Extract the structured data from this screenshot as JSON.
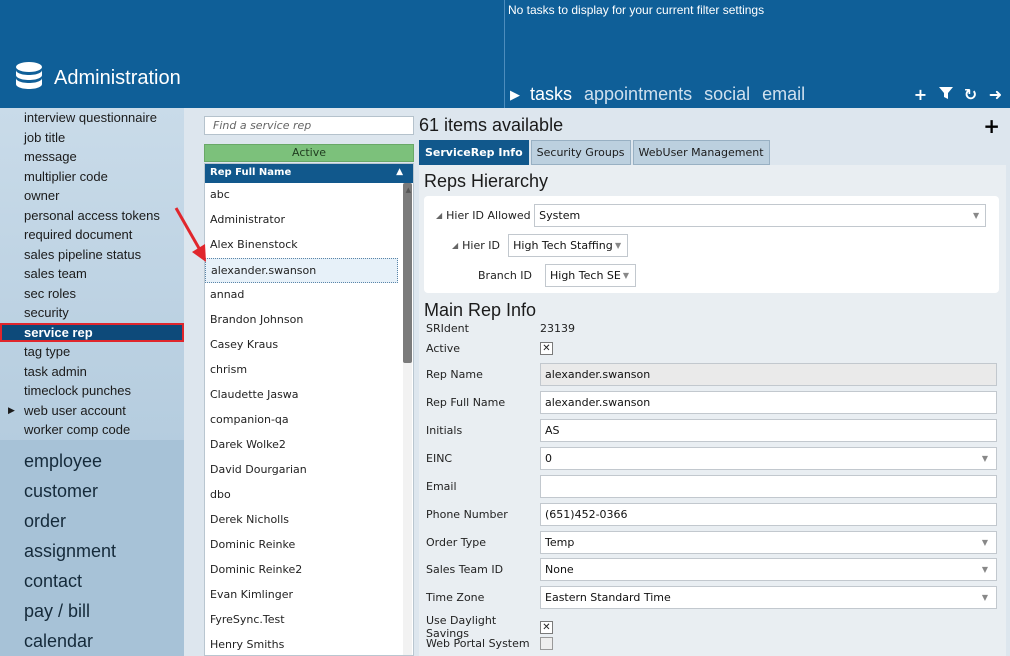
{
  "header": {
    "title": "Administration",
    "tasks_message": "No tasks to display for your current filter settings",
    "tabs": [
      {
        "label": "tasks",
        "active": true
      },
      {
        "label": "appointments",
        "active": false
      },
      {
        "label": "social",
        "active": false
      },
      {
        "label": "email",
        "active": false
      }
    ],
    "actions": [
      "plus-icon",
      "filter-icon",
      "refresh-icon",
      "arrow-right-icon"
    ]
  },
  "sidebar": {
    "sub_items": [
      {
        "label": "interview questionnaire"
      },
      {
        "label": "job title"
      },
      {
        "label": "message"
      },
      {
        "label": "multiplier code"
      },
      {
        "label": "owner"
      },
      {
        "label": "personal access tokens"
      },
      {
        "label": "required document"
      },
      {
        "label": "sales pipeline status"
      },
      {
        "label": "sales team"
      },
      {
        "label": "sec roles"
      },
      {
        "label": "security"
      },
      {
        "label": "service rep",
        "selected": true
      },
      {
        "label": "tag type"
      },
      {
        "label": "task admin"
      },
      {
        "label": "timeclock punches"
      },
      {
        "label": "web user account",
        "expandable": true
      },
      {
        "label": "worker comp code"
      }
    ],
    "main_items": [
      {
        "label": "employee"
      },
      {
        "label": "customer"
      },
      {
        "label": "order"
      },
      {
        "label": "assignment"
      },
      {
        "label": "contact"
      },
      {
        "label": "pay / bill"
      },
      {
        "label": "calendar"
      }
    ]
  },
  "list": {
    "search_placeholder": "Find a service rep",
    "filter_label": "Active",
    "column_header": "Rep Full Name",
    "items": [
      {
        "name": "abc"
      },
      {
        "name": "Administrator"
      },
      {
        "name": "Alex Binenstock"
      },
      {
        "name": "alexander.swanson",
        "selected": true
      },
      {
        "name": "annad"
      },
      {
        "name": "Brandon Johnson"
      },
      {
        "name": "Casey Kraus"
      },
      {
        "name": "chrism"
      },
      {
        "name": "Claudette Jaswa"
      },
      {
        "name": "companion-qa"
      },
      {
        "name": "Darek Wolke2"
      },
      {
        "name": "David Dourgarian"
      },
      {
        "name": "dbo"
      },
      {
        "name": "Derek Nicholls"
      },
      {
        "name": "Dominic Reinke"
      },
      {
        "name": "Dominic Reinke2"
      },
      {
        "name": "Evan Kimlinger"
      },
      {
        "name": "FyreSync.Test"
      },
      {
        "name": "Henry Smiths"
      }
    ]
  },
  "detail": {
    "count_text": "61 items available",
    "tabs": [
      {
        "label": "ServiceRep Info",
        "active": true
      },
      {
        "label": "Security Groups",
        "active": false
      },
      {
        "label": "WebUser Management",
        "active": false
      }
    ],
    "hierarchy": {
      "heading": "Reps Hierarchy",
      "hier_id_allowed_label": "Hier ID Allowed",
      "hier_id_allowed_value": "System",
      "hier_id_label": "Hier ID",
      "hier_id_value": "High Tech Staffing",
      "branch_id_label": "Branch ID",
      "branch_id_value": "High Tech SE"
    },
    "main": {
      "heading": "Main Rep Info",
      "srident_label": "SRIdent",
      "srident_value": "23139",
      "active_label": "Active",
      "active_checked": true,
      "fields": [
        {
          "label": "Rep Name",
          "value": "alexander.swanson",
          "readonly": true
        },
        {
          "label": "Rep Full Name",
          "value": "alexander.swanson"
        },
        {
          "label": "Initials",
          "value": "AS"
        },
        {
          "label": "EINC",
          "value": "0",
          "dropdown": true
        },
        {
          "label": "Email",
          "value": ""
        },
        {
          "label": "Phone Number",
          "value": "(651)452-0366"
        },
        {
          "label": "Order Type",
          "value": "Temp",
          "dropdown": true
        },
        {
          "label": "Sales Team ID",
          "value": "None",
          "dropdown": true
        },
        {
          "label": "Time Zone",
          "value": "Eastern Standard Time",
          "dropdown": true
        }
      ],
      "dst_label": "Use Daylight Savings",
      "dst_checked": true,
      "web_portal_label": "Web Portal System",
      "web_portal_checked": false
    }
  },
  "colors": {
    "header_bg": "#0f5f98",
    "selected_bg": "#0d4a7a",
    "highlight_red": "#e0262c",
    "active_green": "#7cc17b"
  }
}
